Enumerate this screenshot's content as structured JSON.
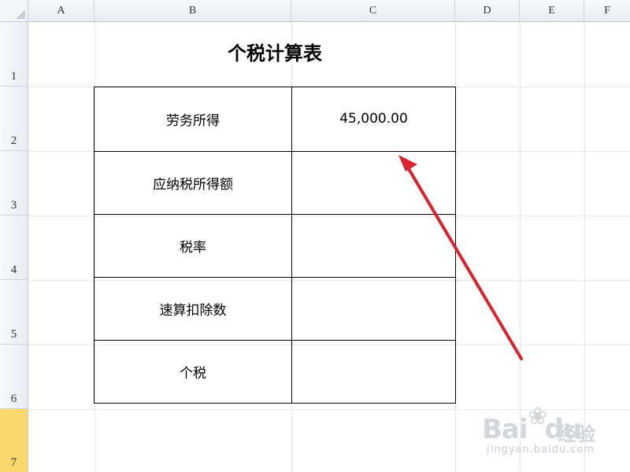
{
  "spreadsheet": {
    "columns": [
      "A",
      "B",
      "C",
      "D",
      "E",
      "F"
    ],
    "rows": [
      "1",
      "2",
      "3",
      "4",
      "5",
      "6",
      "7"
    ],
    "selected_row": "7"
  },
  "title": "个税计算表",
  "tax_table": [
    {
      "label": "劳务所得",
      "value": "45,000.00"
    },
    {
      "label": "应纳税所得额",
      "value": ""
    },
    {
      "label": "税率",
      "value": ""
    },
    {
      "label": "速算扣除数",
      "value": ""
    },
    {
      "label": "个税",
      "value": ""
    }
  ],
  "annotation": {
    "arrow_color": "#d9232e",
    "points_to": "C2"
  },
  "watermark": {
    "brand": "Bai",
    "brand_suffix": "du",
    "cn_text": "经验",
    "url": "jingyan.baidu.com"
  }
}
